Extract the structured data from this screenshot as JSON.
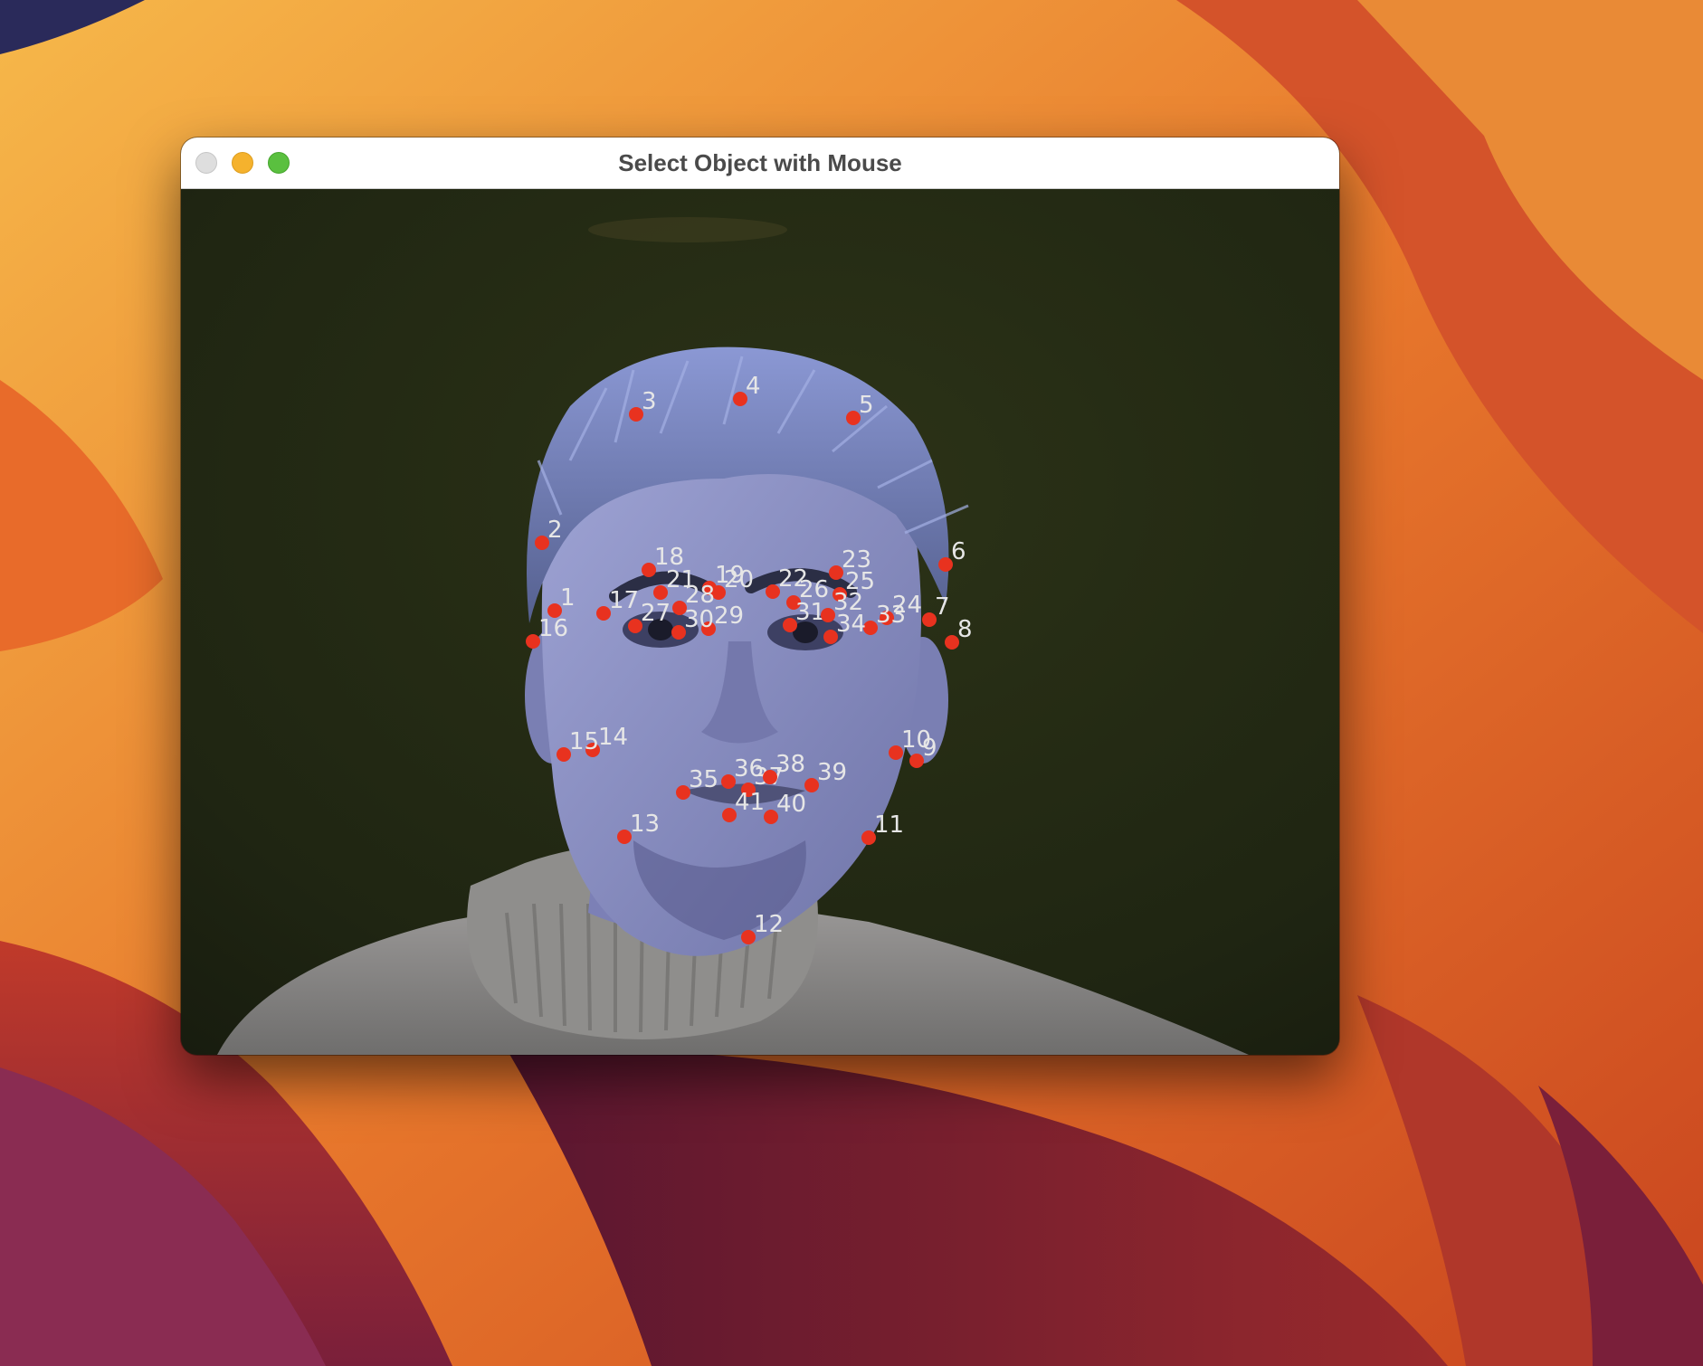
{
  "window": {
    "title": "Select Object with Mouse",
    "controls": {
      "close": "close-button",
      "minimize": "minimize-button",
      "zoom": "zoom-button"
    }
  },
  "landmarks": [
    {
      "id": "1"
    },
    {
      "id": "2"
    },
    {
      "id": "3"
    },
    {
      "id": "4"
    },
    {
      "id": "5"
    },
    {
      "id": "6"
    },
    {
      "id": "7"
    },
    {
      "id": "8"
    },
    {
      "id": "9"
    },
    {
      "id": "10"
    },
    {
      "id": "11"
    },
    {
      "id": "12"
    },
    {
      "id": "13"
    },
    {
      "id": "14"
    },
    {
      "id": "15"
    },
    {
      "id": "16"
    },
    {
      "id": "17"
    },
    {
      "id": "18"
    },
    {
      "id": "19"
    },
    {
      "id": "20"
    },
    {
      "id": "21"
    },
    {
      "id": "22"
    },
    {
      "id": "23"
    },
    {
      "id": "24"
    },
    {
      "id": "25"
    },
    {
      "id": "26"
    },
    {
      "id": "27"
    },
    {
      "id": "28"
    },
    {
      "id": "29"
    },
    {
      "id": "30"
    },
    {
      "id": "31"
    },
    {
      "id": "32"
    },
    {
      "id": "33"
    },
    {
      "id": "34"
    },
    {
      "id": "35"
    },
    {
      "id": "36"
    },
    {
      "id": "37"
    },
    {
      "id": "38"
    },
    {
      "id": "39"
    },
    {
      "id": "40"
    },
    {
      "id": "41"
    }
  ],
  "colors": {
    "marker": "#e8321f",
    "label": "#e6e6e6",
    "background": "#1d2213",
    "skin": "#8a8fc4",
    "hair": "#6f7cb8",
    "sweater": "#8c8b8a"
  }
}
